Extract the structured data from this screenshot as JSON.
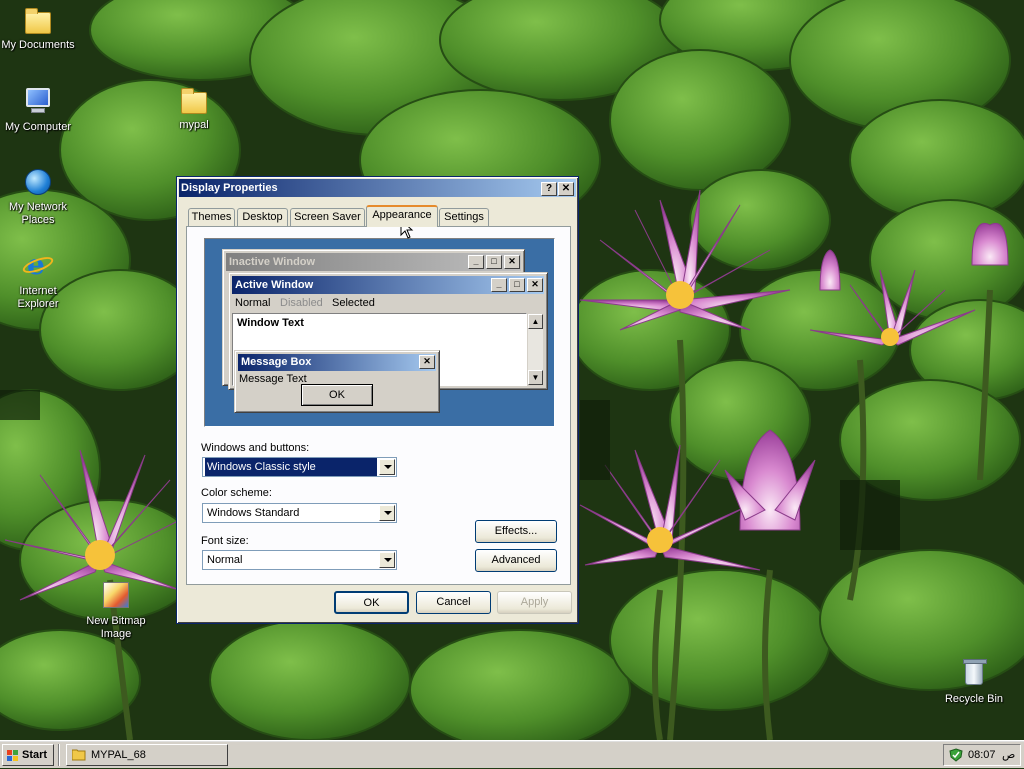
{
  "desktop": {
    "icons": [
      {
        "label": "My Documents",
        "icon": "my-documents-folder-icon"
      },
      {
        "label": "My Computer",
        "icon": "my-computer-icon"
      },
      {
        "label": "mypal",
        "icon": "folder-icon"
      },
      {
        "label": "My Network Places",
        "icon": "network-places-icon"
      },
      {
        "label": "Internet Explorer",
        "icon": "internet-explorer-icon"
      },
      {
        "label": "New Bitmap Image",
        "icon": "bitmap-image-icon"
      },
      {
        "label": "Recycle Bin",
        "icon": "recycle-bin-icon"
      }
    ]
  },
  "dialog": {
    "title": "Display Properties",
    "help_button": "?",
    "close_button": "✕",
    "tabs": [
      "Themes",
      "Desktop",
      "Screen Saver",
      "Appearance",
      "Settings"
    ],
    "active_tab": "Appearance",
    "preview": {
      "inactive_title": "Inactive Window",
      "active_title": "Active Window",
      "menu": [
        "Normal",
        "Disabled",
        "Selected"
      ],
      "window_text": "Window Text",
      "message_title": "Message Box",
      "message_text": "Message Text",
      "ok": "OK"
    },
    "windows_buttons_label": "Windows and buttons:",
    "windows_buttons_value": "Windows Classic style",
    "color_scheme_label": "Color scheme:",
    "color_scheme_value": "Windows Standard",
    "font_size_label": "Font size:",
    "font_size_value": "Normal",
    "effects_button": "Effects...",
    "advanced_button": "Advanced",
    "ok_button": "OK",
    "cancel_button": "Cancel",
    "apply_button": "Apply"
  },
  "taskbar": {
    "start_label": "Start",
    "task_label": "MYPAL_68",
    "clock": "08:07",
    "ampm": "ص"
  },
  "colors": {
    "active_title_start": "#0a246a",
    "active_title_end": "#a6caf0",
    "preview_desktop": "#3a6ea5",
    "face": "#d4d0c8"
  }
}
